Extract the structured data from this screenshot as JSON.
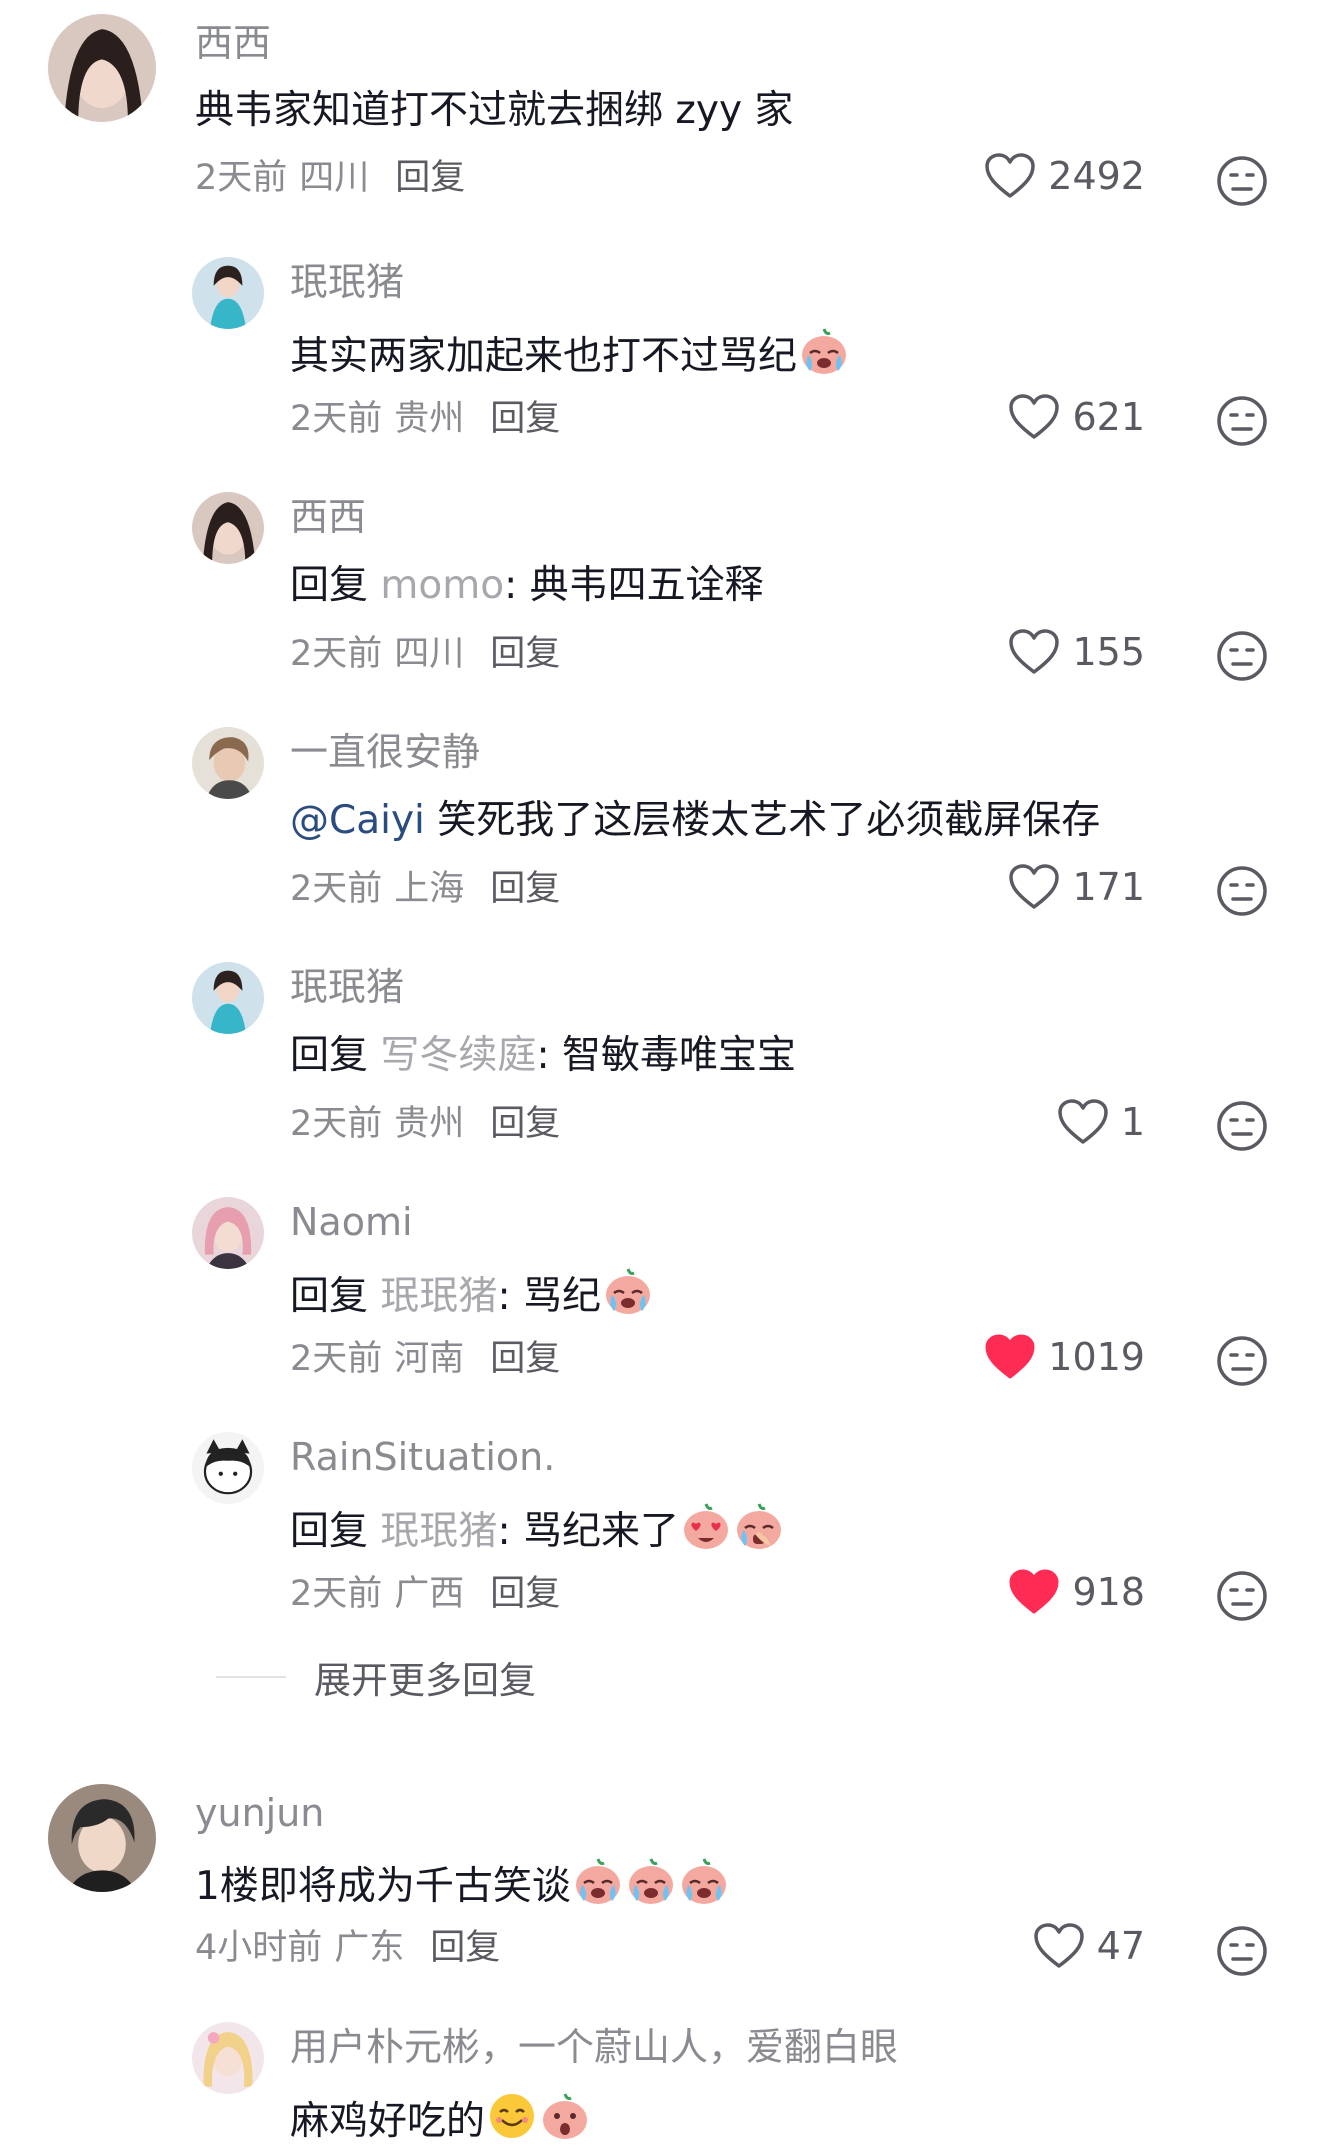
{
  "comments": [
    {
      "user": "西西",
      "text": "典韦家知道打不过就去捆绑 zyy 家",
      "time": "2天前",
      "location": "四川",
      "reply_label": "回复",
      "likes": "2492",
      "liked": false
    },
    {
      "user": "珉珉猪",
      "text": "其实两家加起来也打不过骂纪",
      "time": "2天前",
      "location": "贵州",
      "reply_label": "回复",
      "likes": "621",
      "liked": false,
      "emojis": [
        "crying-face-icon"
      ]
    },
    {
      "user": "西西",
      "prefix": "回复",
      "target": "momo",
      "text": ": 典韦四五诠释",
      "time": "2天前",
      "location": "四川",
      "reply_label": "回复",
      "likes": "155",
      "liked": false
    },
    {
      "user": "一直很安静",
      "mention": "@Caiyi",
      "text": " 笑死我了这层楼太艺术了必须截屏保存",
      "time": "2天前",
      "location": "上海",
      "reply_label": "回复",
      "likes": "171",
      "liked": false
    },
    {
      "user": "珉珉猪",
      "prefix": "回复",
      "target": "写冬续庭",
      "text": ": 智敏毒唯宝宝",
      "time": "2天前",
      "location": "贵州",
      "reply_label": "回复",
      "likes": "1",
      "liked": false
    },
    {
      "user": "Naomi",
      "prefix": "回复",
      "target": "珉珉猪",
      "text": ": 骂纪",
      "time": "2天前",
      "location": "河南",
      "reply_label": "回复",
      "likes": "1019",
      "liked": true,
      "emojis": [
        "crying-face-icon"
      ]
    },
    {
      "user": "RainSituation.",
      "prefix": "回复",
      "target": "珉珉猪",
      "text": ": 骂纪来了",
      "time": "2天前",
      "location": "广西",
      "reply_label": "回复",
      "likes": "918",
      "liked": true,
      "emojis": [
        "heart-eyes-face-icon",
        "sobbing-face-icon"
      ]
    },
    {
      "user": "yunjun",
      "text": "1楼即将成为千古笑谈",
      "time": "4小时前",
      "location": "广东",
      "reply_label": "回复",
      "likes": "47",
      "liked": false,
      "emojis": [
        "crying-face-icon",
        "crying-face-icon",
        "crying-face-icon"
      ]
    },
    {
      "user": "用户朴元彬，一个蔚山人，爱翻白眼",
      "text": "麻鸡好吃的",
      "emojis": [
        "smile-face-icon",
        "shocked-face-icon"
      ]
    }
  ],
  "expand_label": "展开更多回复",
  "colors": {
    "liked_heart": "#fe2c55",
    "muted_text": "#8a8b91",
    "mention": "#2b4c7e"
  }
}
